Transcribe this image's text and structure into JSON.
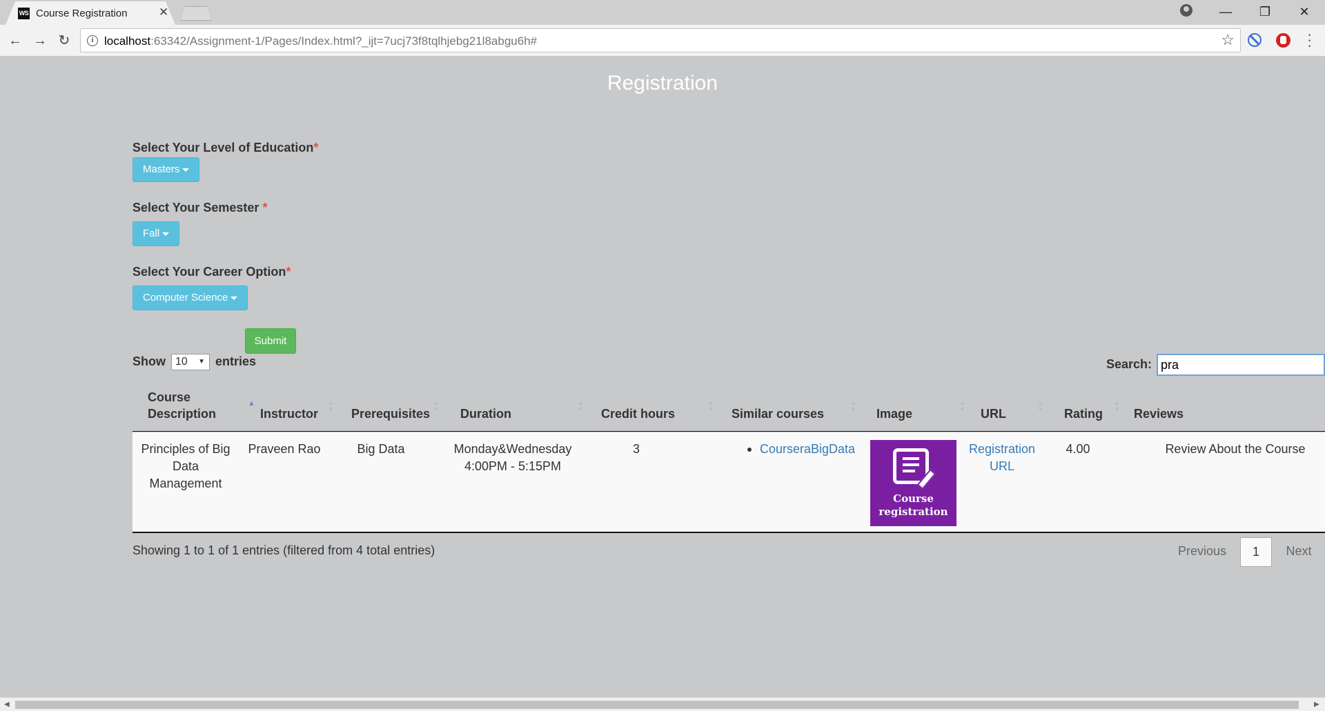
{
  "browser": {
    "tab_title": "Course Registration",
    "tab_favicon": "WS",
    "tab_close": "✕",
    "url_host": "localhost",
    "url_rest": ":63342/Assignment-1/Pages/Index.html?_ijt=7ucj73f8tqlhjebg21l8abgu6h#",
    "window_controls": [
      "—",
      "❐",
      "✕"
    ]
  },
  "page": {
    "title": "Registration"
  },
  "form": {
    "education_label": "Select Your Level of Education",
    "education_value": "Masters",
    "semester_label": "Select Your Semester ",
    "semester_value": "Fall",
    "career_label": "Select Your Career Option",
    "career_value": "Computer Science",
    "required_mark": "*",
    "submit_label": "Submit"
  },
  "table_controls": {
    "show_label": "Show",
    "entries_value": "10",
    "entries_label": "entries",
    "search_label": "Search:",
    "search_value": "pra"
  },
  "table": {
    "headers": [
      "Course Description",
      "Instructor",
      "Prerequisites",
      "Duration",
      "Credit hours",
      "Similar courses",
      "Image",
      "URL",
      "Rating",
      "Reviews"
    ],
    "rows": [
      {
        "course_description": "Principles of Big Data Management",
        "instructor": "Praveen Rao",
        "prerequisites": "Big Data",
        "duration": "Monday&Wednesday 4:00PM - 5:15PM",
        "credit_hours": "3",
        "similar_course": "CourseraBigData",
        "image_caption_1": "Course",
        "image_caption_2": "registration",
        "url_text": "Registration URL",
        "rating": "4.00",
        "reviews": "Review About the Course"
      }
    ]
  },
  "pagination": {
    "info": "Showing 1 to 1 of 1 entries (filtered from 4 total entries)",
    "previous": "Previous",
    "current": "1",
    "next": "Next"
  },
  "colors": {
    "page_bg": "#c8c9cb",
    "dropdown_bg": "#5bc0de",
    "submit_bg": "#5cb85c",
    "link": "#337ab7",
    "course_image_bg": "#7a1fa2"
  }
}
